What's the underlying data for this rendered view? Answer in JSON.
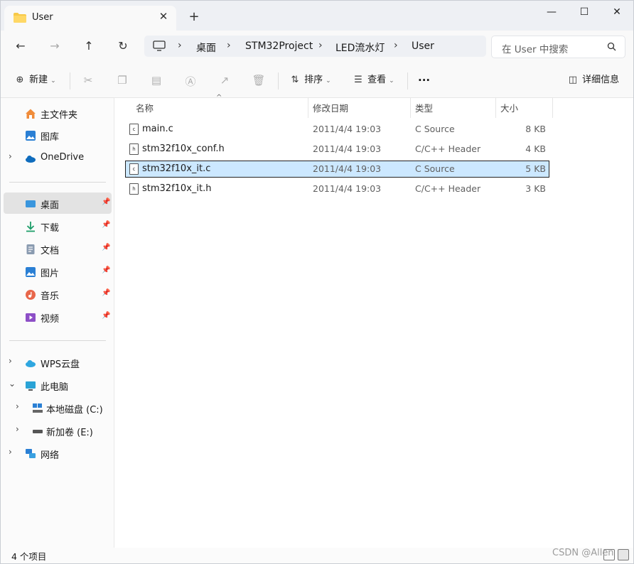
{
  "tab": {
    "title": "User",
    "icon": "folder-icon",
    "close": "✕",
    "new_tab": "+"
  },
  "window_controls": {
    "minimize": "—",
    "maximize": "☐",
    "close": "✕"
  },
  "nav": {
    "back": "←",
    "forward": "→",
    "up": "↑",
    "refresh": "↻"
  },
  "breadcrumb": [
    "桌面",
    "STM32Project",
    "LED流水灯",
    "User"
  ],
  "breadcrumb_sep": "›",
  "search": {
    "placeholder": "在 User 中搜索",
    "icon": "search-icon"
  },
  "commands": {
    "new": "新建",
    "sort": "排序",
    "view": "查看",
    "more": "···",
    "details": "详细信息"
  },
  "sidebar": {
    "top": [
      {
        "label": "主文件夹",
        "icon": "home-icon",
        "expandable": false
      },
      {
        "label": "图库",
        "icon": "gallery-icon",
        "expandable": false
      },
      {
        "label": "OneDrive",
        "icon": "onedrive-icon",
        "expandable": true
      }
    ],
    "pinned": [
      {
        "label": "桌面",
        "icon": "desktop-icon"
      },
      {
        "label": "下载",
        "icon": "download-icon"
      },
      {
        "label": "文档",
        "icon": "documents-icon"
      },
      {
        "label": "图片",
        "icon": "pictures-icon"
      },
      {
        "label": "音乐",
        "icon": "music-icon"
      },
      {
        "label": "视频",
        "icon": "video-icon"
      }
    ],
    "tree": [
      {
        "label": "WPS云盘",
        "icon": "wps-cloud-icon",
        "chev": "›"
      },
      {
        "label": "此电脑",
        "icon": "this-pc-icon",
        "chev": "⌄"
      },
      {
        "label": "本地磁盘 (C:)",
        "icon": "drive-c-icon",
        "chev": "›"
      },
      {
        "label": "新加卷 (E:)",
        "icon": "drive-e-icon",
        "chev": "›"
      },
      {
        "label": "网络",
        "icon": "network-icon",
        "chev": "›"
      }
    ]
  },
  "columns": [
    "名称",
    "修改日期",
    "类型",
    "大小"
  ],
  "files": [
    {
      "name": "main.c",
      "date": "2011/4/4 19:03",
      "type": "C Source",
      "size": "8 KB",
      "selected": false
    },
    {
      "name": "stm32f10x_conf.h",
      "date": "2011/4/4 19:03",
      "type": "C/C++ Header",
      "size": "4 KB",
      "selected": false
    },
    {
      "name": "stm32f10x_it.c",
      "date": "2011/4/4 19:03",
      "type": "C Source",
      "size": "5 KB",
      "selected": true
    },
    {
      "name": "stm32f10x_it.h",
      "date": "2011/4/4 19:03",
      "type": "C/C++ Header",
      "size": "3 KB",
      "selected": false
    }
  ],
  "status": {
    "count": "4 个项目"
  },
  "watermark": "CSDN @Allen"
}
